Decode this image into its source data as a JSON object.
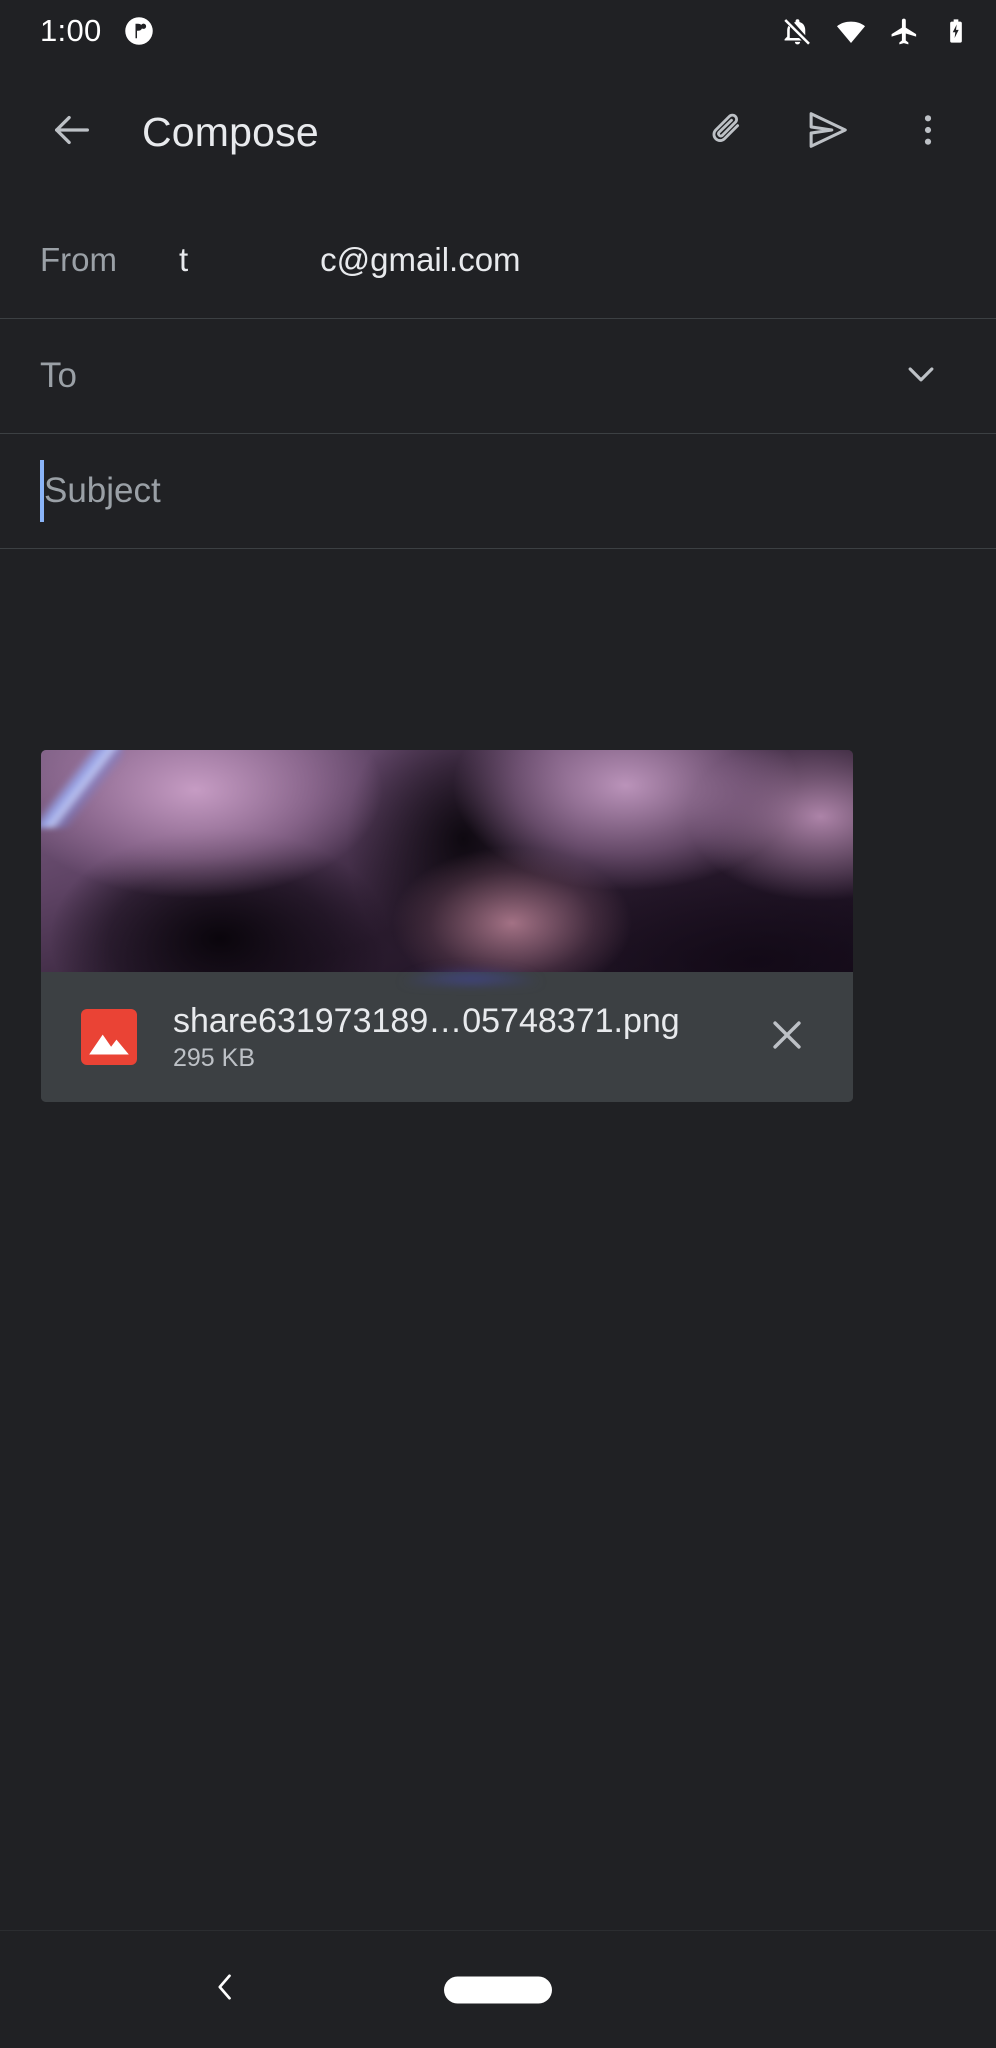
{
  "status_bar": {
    "time": "1:00",
    "notification_icon": "app-notification-icon",
    "right_icons": [
      "notifications-off-icon",
      "wifi-icon",
      "airplane-mode-icon",
      "battery-charging-icon"
    ]
  },
  "app_bar": {
    "back_icon": "back-arrow-icon",
    "title": "Compose",
    "attach_icon": "paperclip-icon",
    "send_icon": "send-icon",
    "more_icon": "more-vertical-icon"
  },
  "fields": {
    "from": {
      "label": "From",
      "value_prefix": "t",
      "value_suffix": "c@gmail.com",
      "redacted": true
    },
    "to": {
      "placeholder": "To",
      "value": "",
      "expand_icon": "chevron-down-icon"
    },
    "subject": {
      "placeholder": "Subject",
      "value": "",
      "focused": true,
      "caret_color": "#8ab4f8"
    },
    "body": {
      "placeholder": "",
      "value": ""
    }
  },
  "attachment": {
    "file_name": "share631973189…05748371.png",
    "file_size": "295 KB",
    "file_type_icon": "image-file-icon",
    "file_icon_color": "#ea4335",
    "remove_icon": "close-icon",
    "thumbnail_description": "blurred purple image preview"
  },
  "nav_bar": {
    "back_icon": "nav-back-chevron-icon",
    "home_icon": "nav-home-pill-icon"
  },
  "theme": {
    "background": "#202124",
    "surface": "#3c4043",
    "divider": "#3c4043",
    "text_primary": "#e8eaed",
    "text_secondary": "#9aa0a6",
    "accent": "#8ab4f8"
  }
}
